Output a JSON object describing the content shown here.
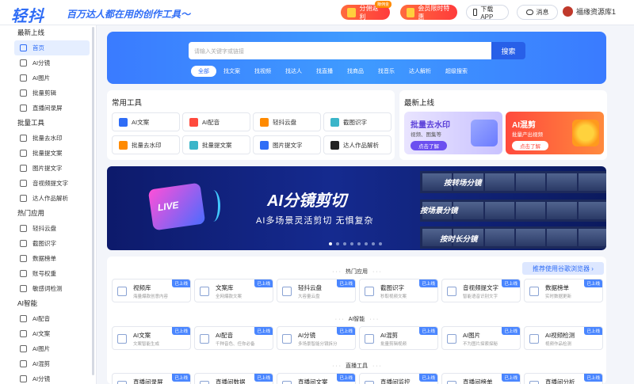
{
  "header": {
    "logo": "轻抖",
    "slogan": "百万达人都在用的创作工具～",
    "share_rebate": "分佣返利",
    "share_tag": "赚佣金",
    "vip_offer": "会员限时特惠",
    "download_app": "下载APP",
    "messages": "消息",
    "username": "福缘资源库1"
  },
  "sidebar": {
    "sections": [
      {
        "title": "最新上线",
        "items": [
          "首页",
          "AI分镜",
          "AI图片",
          "批量剪辑",
          "直播间录屏"
        ]
      },
      {
        "title": "批量工具",
        "items": [
          "批量去水印",
          "批量提文案",
          "图片提文字",
          "音视频提文字",
          "达人作品解析"
        ]
      },
      {
        "title": "热门应用",
        "items": [
          "轻抖云盘",
          "截图识字",
          "数据榜单",
          "账号权重",
          "敏感词检测"
        ]
      },
      {
        "title": "AI智能",
        "items": [
          "AI配音",
          "AI文案",
          "AI图片",
          "AI混剪",
          "AI分镜"
        ]
      }
    ]
  },
  "search": {
    "placeholder": "请输入关键字或链接",
    "button": "搜索",
    "filters": [
      "全部",
      "找文案",
      "找视频",
      "找达人",
      "找直播",
      "找商品",
      "找音乐",
      "达人解析",
      "超级搜索"
    ]
  },
  "common_tools": {
    "title": "常用工具",
    "items": [
      "AI文案",
      "AI配音",
      "轻抖云盘",
      "截图识字",
      "批量去水印",
      "批量提文案",
      "图片提文字",
      "达人作品解析"
    ]
  },
  "latest": {
    "title": "最新上线",
    "card1": {
      "title": "批量去水印",
      "sub": "视频、图集等",
      "btn": "点击了解"
    },
    "card2": {
      "title": "AI混剪",
      "sub": "批量产出视频",
      "btn": "点击了解"
    }
  },
  "banner": {
    "title": "AI分镜剪切",
    "subtitle": "AI多场景灵活剪切 无惧复杂",
    "live": "LIVE",
    "labels": [
      "按转场分镜",
      "按场景分镜",
      "按时长分镜"
    ]
  },
  "tools_list": {
    "recommend": "推荐使用谷歌浏览器",
    "badge": "已上线",
    "categories": [
      {
        "name": "热门应用",
        "items": [
          {
            "t": "视频库",
            "s": "海量爆款创意内容"
          },
          {
            "t": "文案库",
            "s": "全网爆款文案"
          },
          {
            "t": "轻抖云盘",
            "s": "大容量云盘"
          },
          {
            "t": "截图识字",
            "s": "秒取视频文案"
          },
          {
            "t": "音视频提文字",
            "s": "智能语音识别文字"
          },
          {
            "t": "数据榜单",
            "s": "实时数据更新"
          }
        ]
      },
      {
        "name": "AI智能",
        "items": [
          {
            "t": "AI文案",
            "s": "文案智能生成"
          },
          {
            "t": "AI配音",
            "s": "千种音色、任你必备"
          },
          {
            "t": "AI分镜",
            "s": "多场景智能分镜拆分"
          },
          {
            "t": "AI混剪",
            "s": "批量剪辑视频"
          },
          {
            "t": "AI图片",
            "s": "不为图片探索探秘"
          },
          {
            "t": "AI视频检测",
            "s": "视频作品检测"
          }
        ]
      },
      {
        "name": "直播工具",
        "items": [
          {
            "t": "直播间录屏",
            "s": ""
          },
          {
            "t": "直播间数据",
            "s": ""
          },
          {
            "t": "直播间文案",
            "s": ""
          },
          {
            "t": "直播间监控",
            "s": ""
          },
          {
            "t": "直播间榜单",
            "s": ""
          },
          {
            "t": "直播间分析",
            "s": ""
          }
        ]
      }
    ]
  },
  "colors": {
    "brand": "#2f6df6",
    "accent_red": "#ff3b3b"
  }
}
